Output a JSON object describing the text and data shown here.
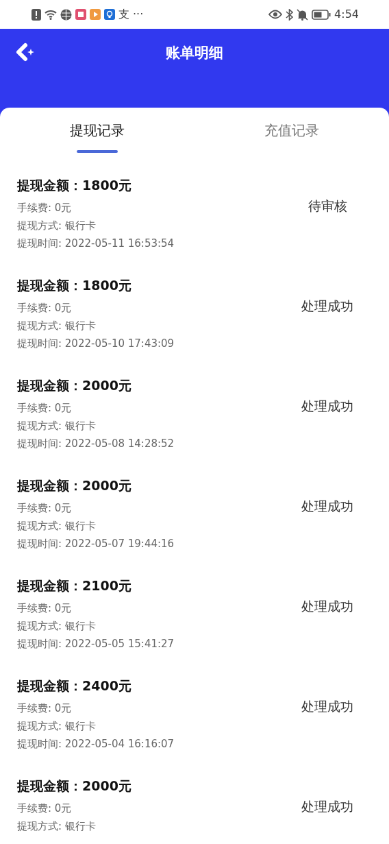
{
  "status_bar": {
    "notification_text": "支",
    "more": "···",
    "time": "4:54"
  },
  "header": {
    "title": "账单明细"
  },
  "tabs": [
    {
      "label": "提现记录",
      "selected": true
    },
    {
      "label": "充值记录",
      "selected": false
    }
  ],
  "records": [
    {
      "amount": "提现金额：1800元",
      "fee": "手续费: 0元",
      "method": "提现方式: 银行卡",
      "time": "提现时间: 2022-05-11 16:53:54",
      "status": "待审核"
    },
    {
      "amount": "提现金额：1800元",
      "fee": "手续费: 0元",
      "method": "提现方式: 银行卡",
      "time": "提现时间: 2022-05-10 17:43:09",
      "status": "处理成功"
    },
    {
      "amount": "提现金额：2000元",
      "fee": "手续费: 0元",
      "method": "提现方式: 银行卡",
      "time": "提现时间: 2022-05-08 14:28:52",
      "status": "处理成功"
    },
    {
      "amount": "提现金额：2000元",
      "fee": "手续费: 0元",
      "method": "提现方式: 银行卡",
      "time": "提现时间: 2022-05-07 19:44:16",
      "status": "处理成功"
    },
    {
      "amount": "提现金额：2100元",
      "fee": "手续费: 0元",
      "method": "提现方式: 银行卡",
      "time": "提现时间: 2022-05-05 15:41:27",
      "status": "处理成功"
    },
    {
      "amount": "提现金额：2400元",
      "fee": "手续费: 0元",
      "method": "提现方式: 银行卡",
      "time": "提现时间: 2022-05-04 16:16:07",
      "status": "处理成功"
    },
    {
      "amount": "提现金额：2000元",
      "fee": "手续费: 0元",
      "method": "提现方式: 银行卡",
      "status": "处理成功"
    }
  ]
}
